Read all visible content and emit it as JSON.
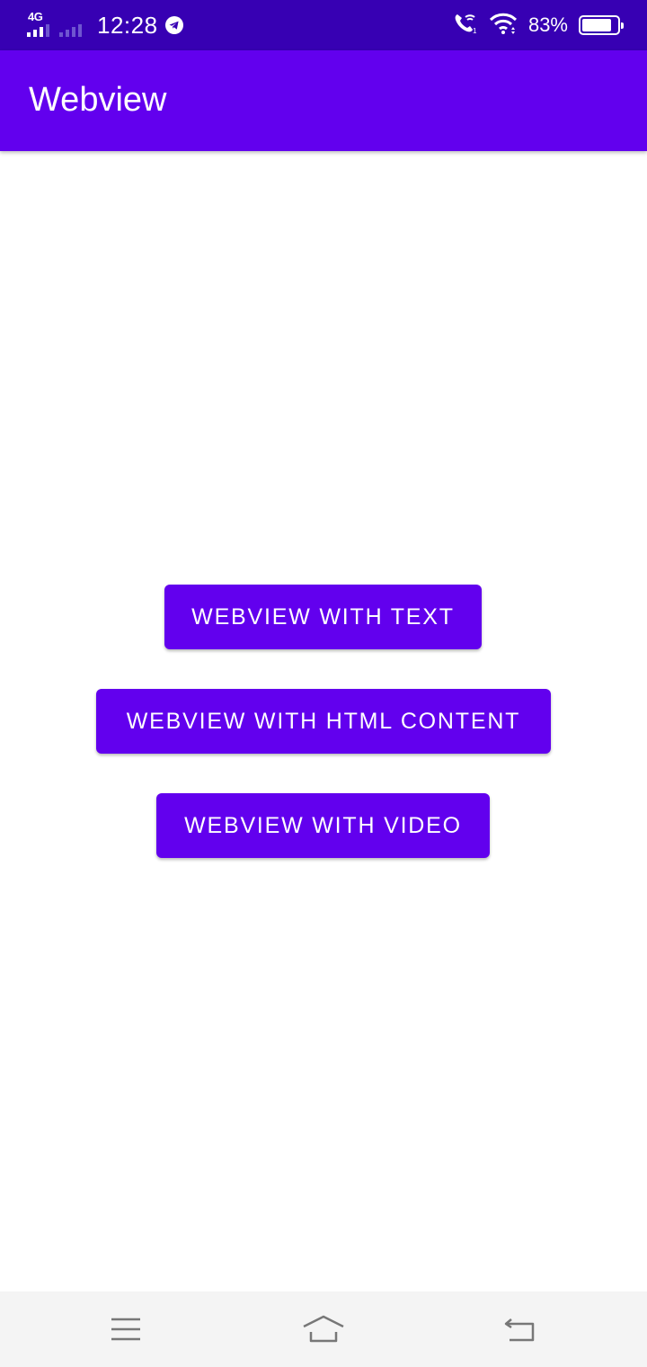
{
  "status_bar": {
    "network_type": "4G",
    "time": "12:28",
    "battery_percent": "83%",
    "battery_level": 0.83,
    "icons": [
      "signal-sim1-icon",
      "signal-sim2-icon",
      "telegram-icon",
      "wifi-call-icon",
      "wifi-icon",
      "battery-icon"
    ]
  },
  "app_bar": {
    "title": "Webview"
  },
  "main": {
    "buttons": [
      {
        "label": "WEBVIEW WITH TEXT"
      },
      {
        "label": "WEBVIEW WITH HTML CONTENT"
      },
      {
        "label": "WEBVIEW WITH VIDEO"
      }
    ]
  },
  "nav_bar": {
    "icons": [
      "menu-icon",
      "home-icon",
      "back-icon"
    ]
  },
  "colors": {
    "status_bar": "#3700b3",
    "primary": "#6200ee",
    "on_primary": "#ffffff",
    "background": "#ffffff",
    "nav_bar": "#f4f4f4"
  }
}
